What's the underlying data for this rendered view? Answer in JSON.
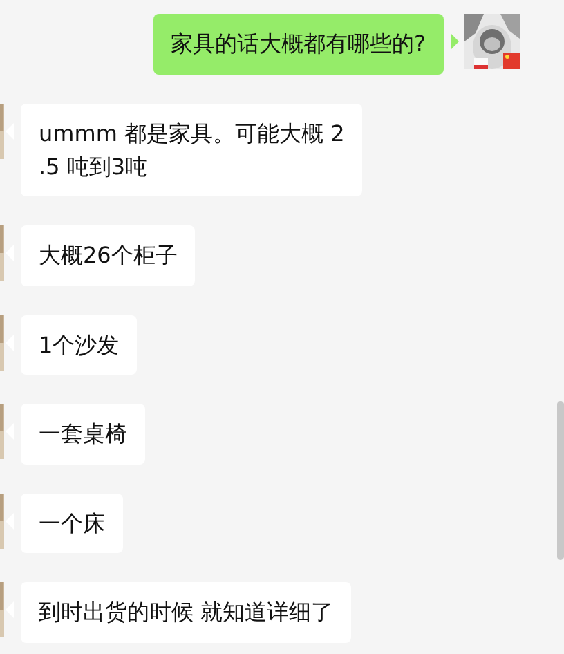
{
  "messages": [
    {
      "kind": "sent",
      "lines": [
        "家具的话大概都有哪些的?"
      ]
    },
    {
      "kind": "received",
      "lines": [
        "ummm 都是家具。可能大概 2",
        ".5 吨到3吨"
      ]
    },
    {
      "kind": "received",
      "lines": [
        "大概26个柜子"
      ]
    },
    {
      "kind": "received",
      "lines": [
        "1个沙发"
      ]
    },
    {
      "kind": "received",
      "lines": [
        "一套桌椅"
      ]
    },
    {
      "kind": "received",
      "lines": [
        "一个床"
      ]
    },
    {
      "kind": "received",
      "lines": [
        "到时出货的时候 就知道详细了"
      ]
    }
  ]
}
